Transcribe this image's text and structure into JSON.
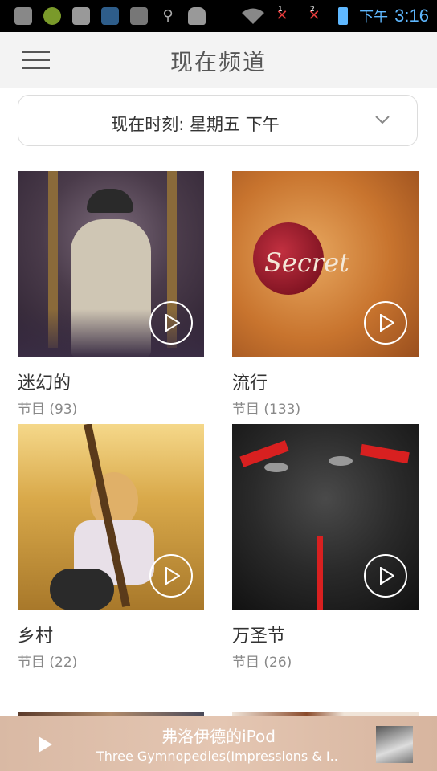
{
  "statusbar": {
    "ampm": "下午",
    "time": "3:16",
    "icons": [
      "add-icon",
      "app-icon",
      "clipboard-icon",
      "app-l-icon",
      "check-icon",
      "usb-icon",
      "android-icon",
      "wifi-icon",
      "signal-1-icon",
      "signal-2-icon",
      "battery-icon"
    ],
    "sim1": "1",
    "sim2": "2"
  },
  "appbar": {
    "title": "现在频道",
    "menu_icon": "hamburger-menu-icon"
  },
  "time_selector": {
    "label": "现在时刻: 星期五 下午",
    "icon": "chevron-down-icon"
  },
  "channels": [
    {
      "name": "迷幻的",
      "count": "节目 (93)"
    },
    {
      "name": "流行",
      "count": "节目 (133)"
    },
    {
      "name": "乡村",
      "count": "节目 (22)"
    },
    {
      "name": "万圣节",
      "count": "节目 (26)"
    }
  ],
  "now_playing": {
    "station": "弗洛伊德的iPod",
    "track": "Three Gymnopedies(Impressions & I..."
  },
  "colors": {
    "accent": "#5fb8ff",
    "player_bg": "#dcbca7"
  }
}
